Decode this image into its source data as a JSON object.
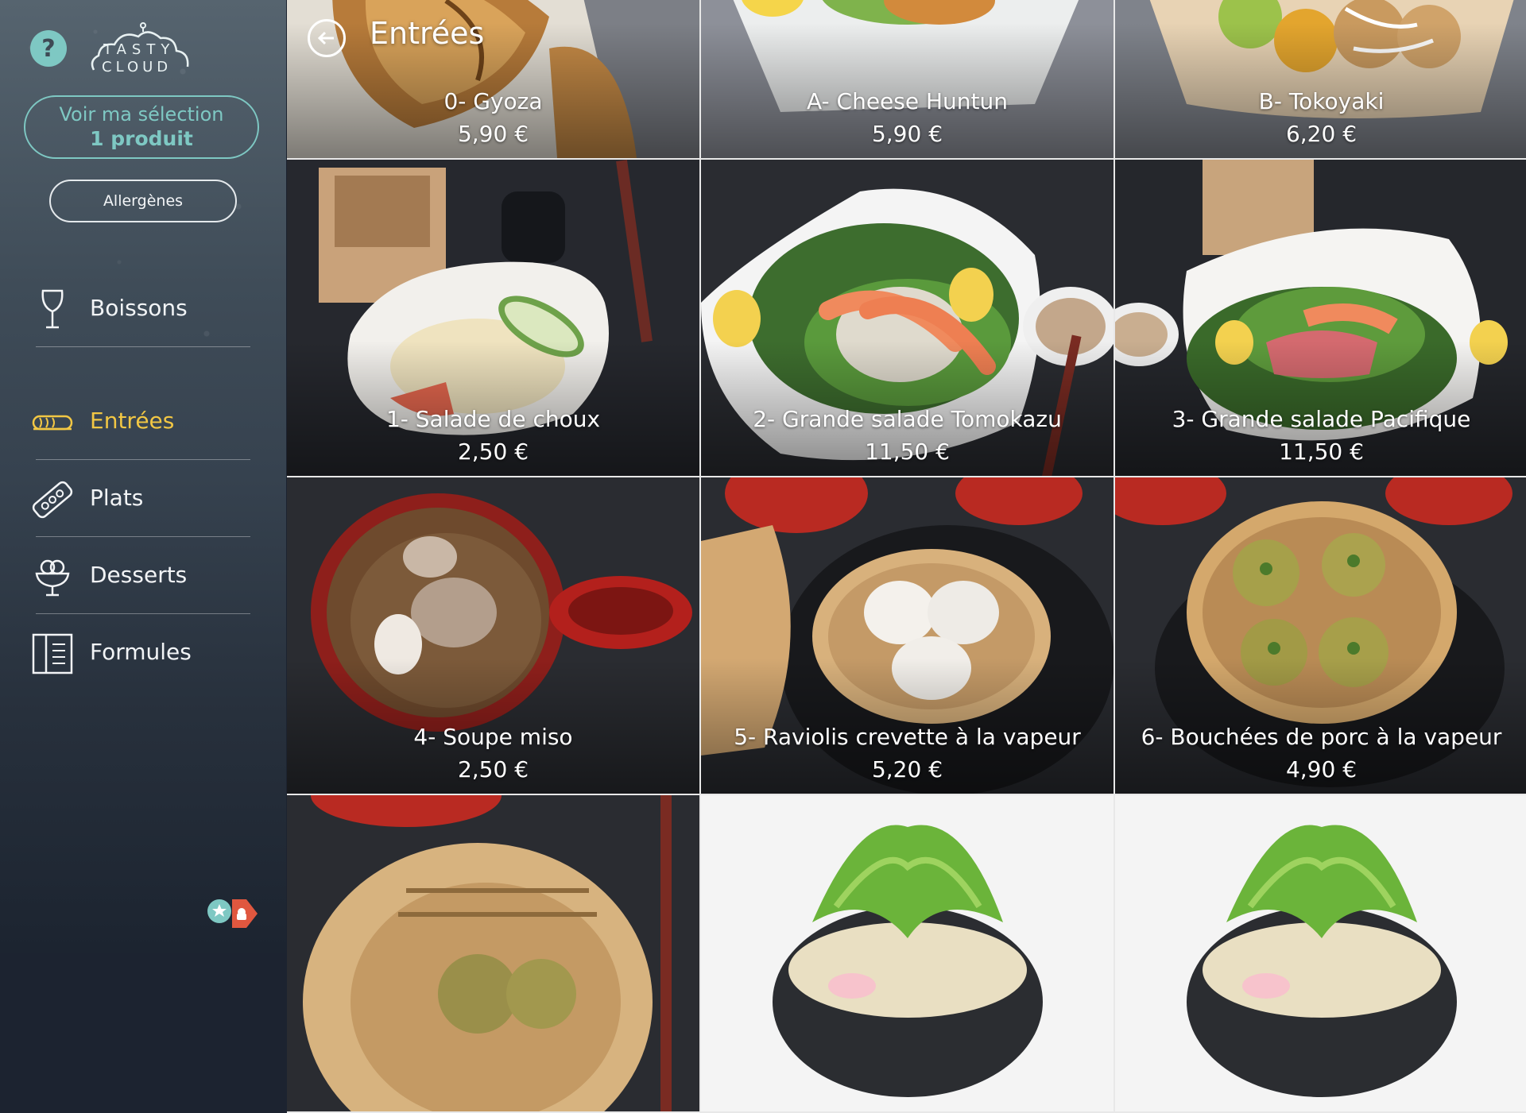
{
  "app": {
    "help_label": "?",
    "logo_line1": "TASTY",
    "logo_line2": "CLOUD"
  },
  "sidebar": {
    "selection": {
      "label": "Voir ma sélection",
      "count": "1 produit"
    },
    "allergens_label": "Allergènes",
    "items": [
      {
        "label": "Boissons",
        "icon": "wine-glass-icon",
        "active": false
      },
      {
        "label": "Entrées",
        "icon": "spring-roll-icon",
        "active": true
      },
      {
        "label": "Plats",
        "icon": "sushi-board-icon",
        "active": false
      },
      {
        "label": "Desserts",
        "icon": "ice-cream-icon",
        "active": false
      },
      {
        "label": "Formules",
        "icon": "menu-book-icon",
        "active": false
      }
    ]
  },
  "header": {
    "title": "Entrées"
  },
  "colors": {
    "accent": "#7ec8c3",
    "active": "#f2c744",
    "sidebar": "#3f4c58"
  },
  "products": [
    {
      "name": "0- Gyoza",
      "price": "5,90 €"
    },
    {
      "name": "A- Cheese Huntun",
      "price": "5,90 €"
    },
    {
      "name": "B- Tokoyaki",
      "price": "6,20 €"
    },
    {
      "name": "1- Salade de choux",
      "price": "2,50 €"
    },
    {
      "name": "2- Grande salade Tomokazu",
      "price": "11,50 €"
    },
    {
      "name": "3- Grande salade Pacifique",
      "price": "11,50 €"
    },
    {
      "name": "4- Soupe miso",
      "price": "2,50 €"
    },
    {
      "name": "5- Raviolis crevette à la vapeur",
      "price": "5,20 €"
    },
    {
      "name": "6- Bouchées de porc à la vapeur",
      "price": "4,90 €"
    },
    {
      "name": "",
      "price": ""
    },
    {
      "name": "",
      "price": ""
    },
    {
      "name": "",
      "price": ""
    }
  ]
}
